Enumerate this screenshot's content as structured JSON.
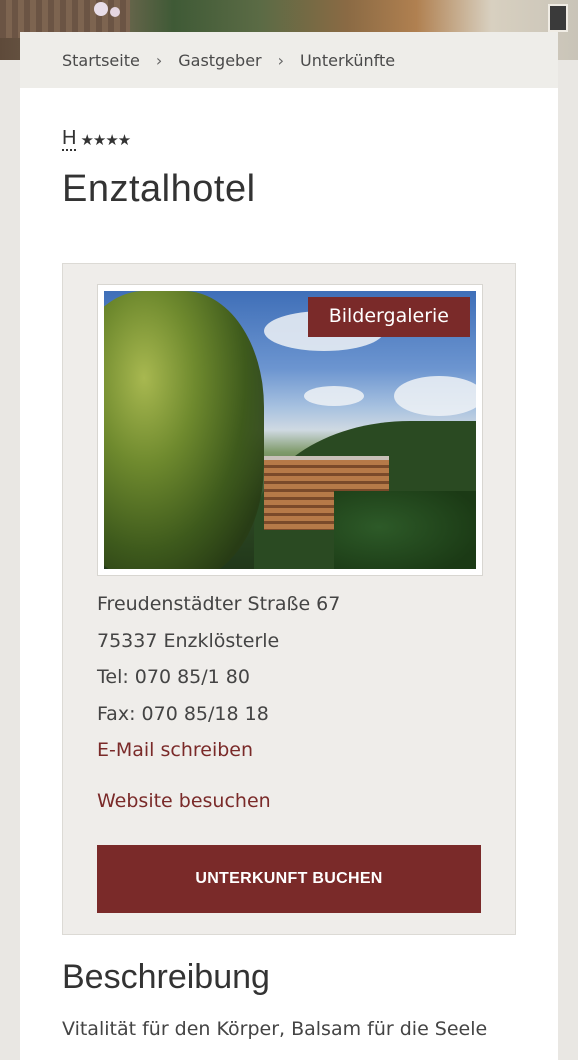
{
  "breadcrumb": {
    "items": [
      "Startseite",
      "Gastgeber",
      "Unterkünfte"
    ],
    "separator": ">"
  },
  "rating": {
    "label": "H",
    "stars": "★★★★",
    "star_count": 4
  },
  "title": "Enztalhotel",
  "gallery": {
    "button_label": "Bildergalerie"
  },
  "contact": {
    "street": "Freudenstädter Straße 67",
    "city": "75337 Enzklösterle",
    "tel": "Tel: 070 85/1 80",
    "fax": "Fax: 070 85/18 18",
    "email_link": "E-Mail schreiben",
    "website_link": "Website besuchen"
  },
  "book_button": "UNTERKUNFT BUCHEN",
  "description": {
    "heading": "Beschreibung",
    "text": "Vitalität für den Körper, Balsam für die Seele"
  },
  "colors": {
    "accent": "#7a2a29",
    "card_bg": "#efedea",
    "page_bg": "#ecebe8"
  }
}
